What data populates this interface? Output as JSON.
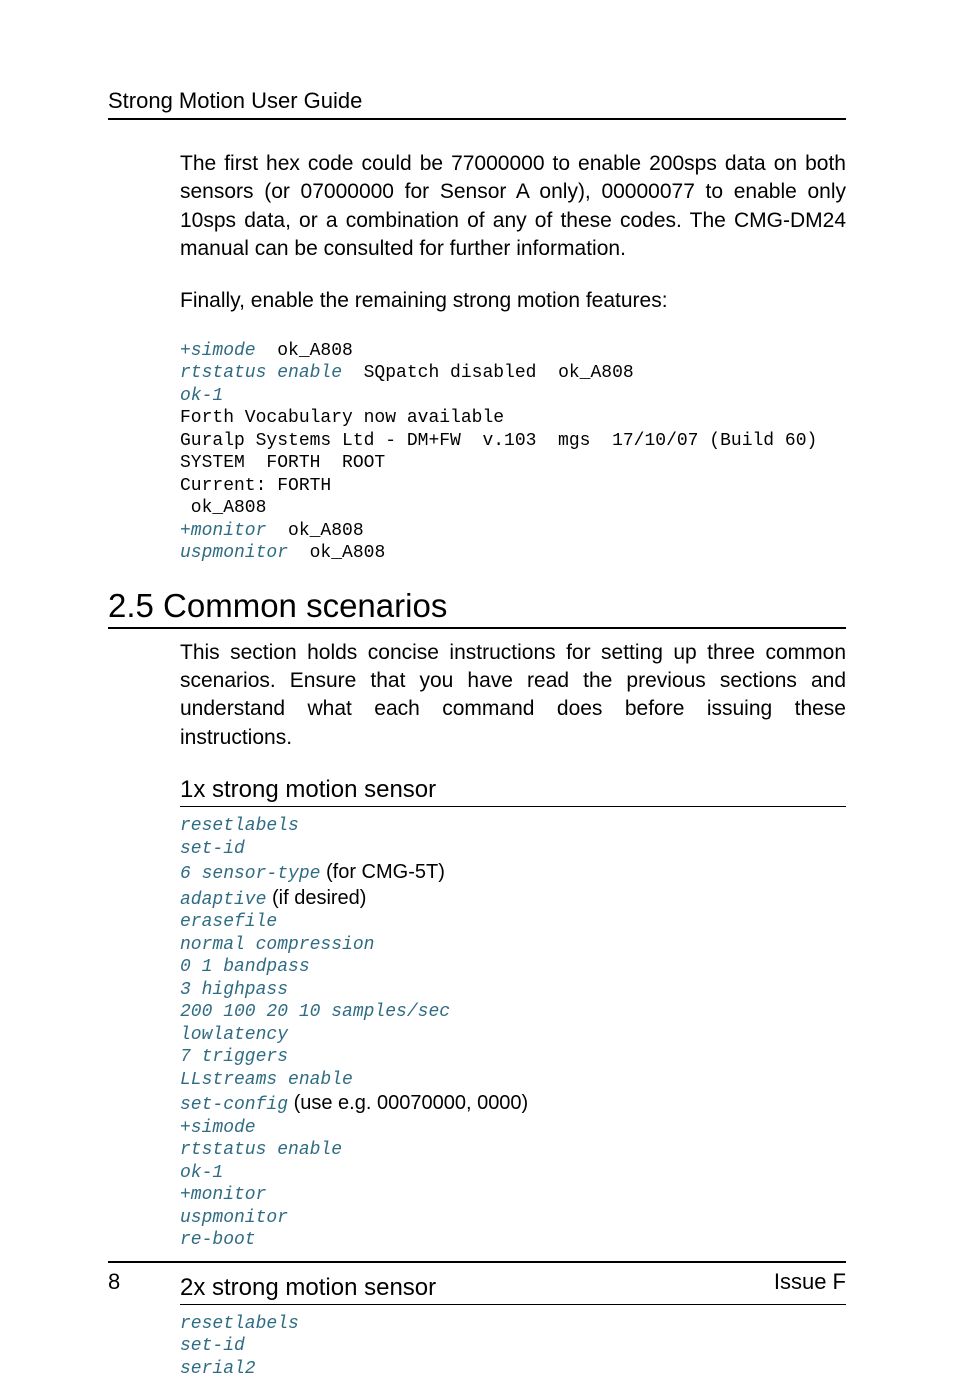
{
  "header": {
    "running": "Strong Motion User Guide"
  },
  "para1": "The first hex code could be 77000000 to enable 200sps data on both sensors (or 07000000 for Sensor A only), 00000077 to enable only 10sps data, or a combination of any of these codes. The CMG-DM24 manual can be consulted for further information.",
  "para2": "Finally, enable the remaining strong motion features:",
  "code1": {
    "l1u": "+simode",
    "l1o": "  ok_A808",
    "l2u": "rtstatus enable",
    "l2o": "  SQpatch disabled  ok_A808",
    "l3u": "ok-1",
    "l4o": "Forth Vocabulary now available",
    "l5o": "Guralp Systems Ltd - DM+FW  v.103  mgs  17/10/07 (Build 60)",
    "l6o": "SYSTEM  FORTH  ROOT",
    "l7o": "Current: FORTH",
    "l8o": " ok_A808",
    "l9u": "+monitor",
    "l9o": "  ok_A808",
    "l10u": "uspmonitor",
    "l10o": "  ok_A808"
  },
  "h2": "2.5 Common scenarios",
  "para3": "This section holds concise instructions for setting up three common scenarios. Ensure that you have read the previous sections and understand what each command does before issuing these instructions.",
  "h3a": "1x strong motion sensor",
  "code2": {
    "l1": "resetlabels",
    "l2": "set-id",
    "l3u": "6 sensor-type",
    "l3n": " (for CMG-5T)",
    "l4u": "adaptive",
    "l4n": " (if desired)",
    "l5": "erasefile",
    "l6": "normal compression",
    "l7": "0 1 bandpass",
    "l8": "3 highpass",
    "l9": "200 100 20 10 samples/sec",
    "l10": "lowlatency",
    "l11": "7 triggers",
    "l12": "LLstreams enable",
    "l13u": "set-config",
    "l13n": " (use e.g. 00070000, 0000)",
    "l14": "+simode",
    "l15": "rtstatus enable",
    "l16": "ok-1",
    "l17": "+monitor",
    "l18": "uspmonitor",
    "l19": "re-boot"
  },
  "h3b": "2x strong motion sensor",
  "code3": {
    "l1": "resetlabels",
    "l2": "set-id",
    "l3": "serial2"
  },
  "footer": {
    "pageno": "8",
    "issue": "Issue F"
  }
}
